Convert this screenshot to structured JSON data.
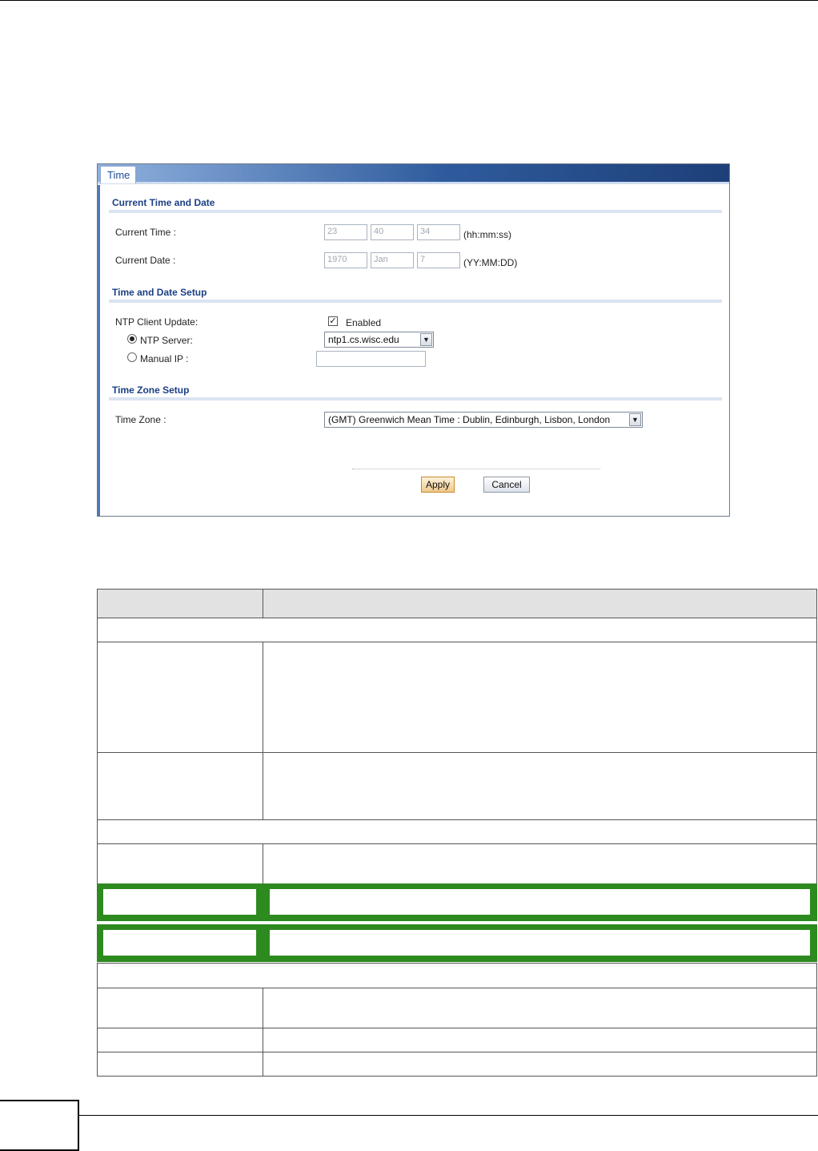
{
  "tab": {
    "label": "Time"
  },
  "sections": {
    "current": "Current Time and Date",
    "setup": "Time and Date Setup",
    "zone": "Time Zone Setup"
  },
  "current_time": {
    "label": "Current Time :",
    "hh": "23",
    "mm": "40",
    "ss": "34",
    "unit": "(hh:mm:ss)"
  },
  "current_date": {
    "label": "Current Date :",
    "yy": "1970",
    "mm": "Jan",
    "dd": "7",
    "unit": "(YY:MM:DD)"
  },
  "ntp": {
    "label": "NTP Client Update:",
    "enabled_checked": true,
    "enabled_label": "Enabled",
    "server_label": "NTP Server:",
    "server_selected": true,
    "server_value": "ntp1.cs.wisc.edu",
    "manual_label": "Manual IP :",
    "manual_value": ""
  },
  "timezone": {
    "label": "Time Zone :",
    "value": "(GMT) Greenwich Mean Time : Dublin, Edinburgh, Lisbon, London"
  },
  "buttons": {
    "apply": "Apply",
    "cancel": "Cancel"
  },
  "colors": {
    "highlight_border": "#2d8a1f",
    "header_bg": "#e2e2e2",
    "accent": "#1b3f84"
  }
}
